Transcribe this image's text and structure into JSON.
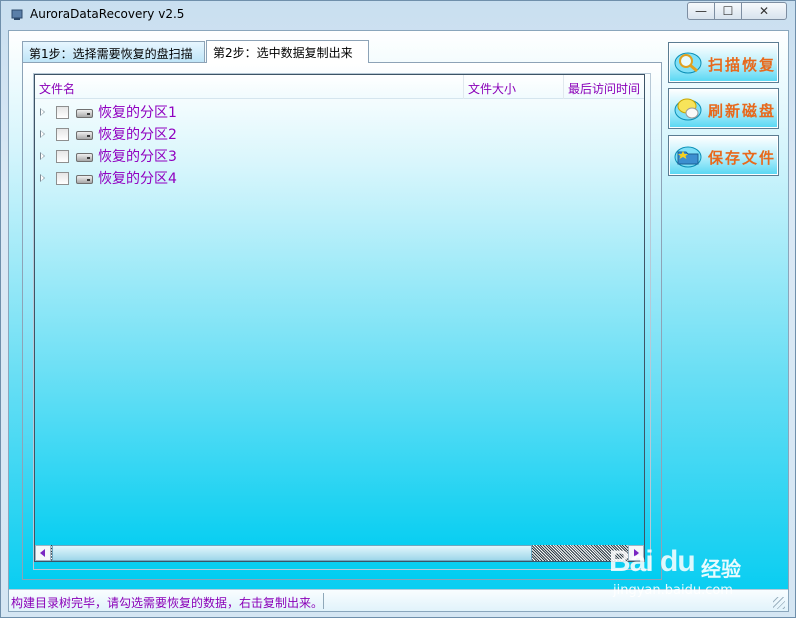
{
  "window": {
    "title": "AuroraDataRecovery v2.5",
    "controls": {
      "minimize": "—",
      "maximize": "☐",
      "close": "✕"
    }
  },
  "tabs": [
    {
      "label": "第1步：选择需要恢复的盘扫描",
      "active": false
    },
    {
      "label": "第2步：选中数据复制出来",
      "active": true
    }
  ],
  "tree": {
    "columns": [
      "文件名",
      "文件大小",
      "最后访问时间"
    ],
    "rows": [
      {
        "label": "恢复的分区1",
        "checked": false,
        "icon": "drive-icon"
      },
      {
        "label": "恢复的分区2",
        "checked": false,
        "icon": "drive-icon"
      },
      {
        "label": "恢复的分区3",
        "checked": false,
        "icon": "drive-icon"
      },
      {
        "label": "恢复的分区4",
        "checked": false,
        "icon": "drive-icon"
      }
    ]
  },
  "actions": [
    {
      "label": "扫描恢复",
      "icon": "magnifier-icon"
    },
    {
      "label": "刷新磁盘",
      "icon": "refresh-icon"
    },
    {
      "label": "保存文件",
      "icon": "save-folder-icon"
    }
  ],
  "status": {
    "text": "构建目录树完毕，请勾选需要恢复的数据，右击复制出来。"
  },
  "watermark": {
    "logo": "Bai du",
    "cn": "经验",
    "url": "jingyan.baidu.com"
  },
  "colors": {
    "accent": "#9000c0",
    "button_text": "#e8691c",
    "panel_bottom": "#00cdf1"
  }
}
